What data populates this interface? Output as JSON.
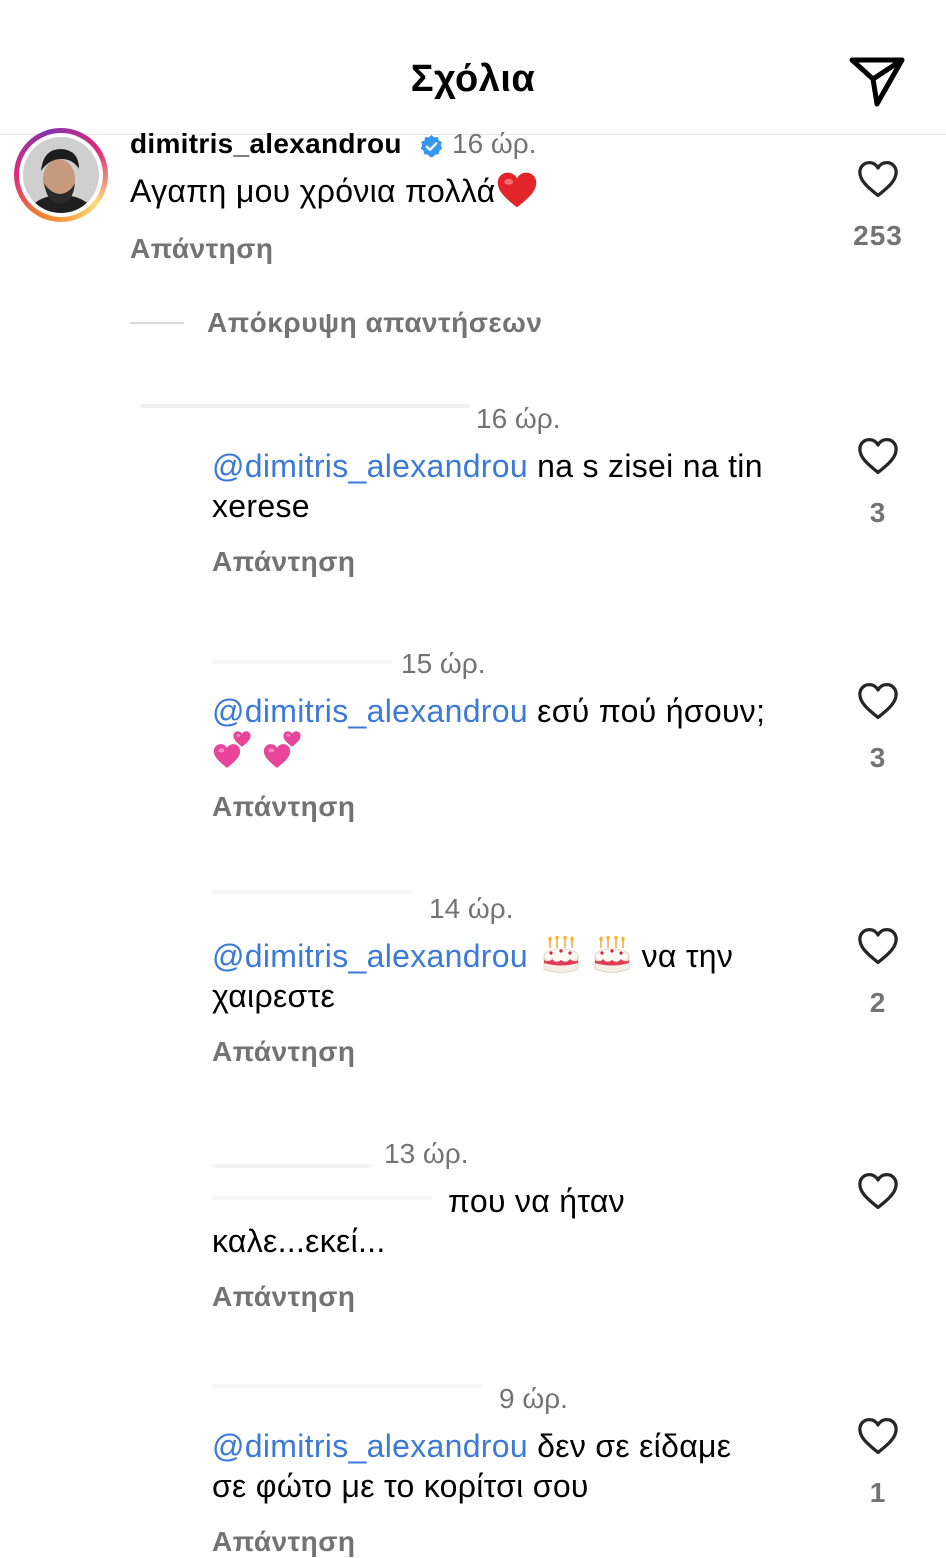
{
  "header": {
    "title": "Σχόλια"
  },
  "icons": {
    "send": "send-paper-plane-icon",
    "like": "heart-outline-icon",
    "verified": "verified-badge-icon"
  },
  "colors": {
    "mention": "#3b7ad8",
    "muted": "#737373",
    "verified": "#3797f0"
  },
  "main_comment": {
    "username": "dimitris_alexandrou",
    "time": "16 ώρ.",
    "text": "Αγαπη μου χρόνια  πολλά",
    "emoji": "red-heart",
    "reply": "Απάντηση",
    "likes": "253"
  },
  "hide_replies": "Απόκρυψη απαντήσεων",
  "replies": [
    {
      "time": "16 ώρ.",
      "mention": "@dimitris_alexandrou",
      "text_line1": " na s zisei na tin",
      "text_line2": "xerese",
      "reply": "Απάντηση",
      "likes": "3"
    },
    {
      "time": "15 ώρ.",
      "mention": "@dimitris_alexandrou",
      "text_line1": " εσύ πού ήσουν;",
      "emoji": "two-hearts",
      "reply": "Απάντηση",
      "likes": "3"
    },
    {
      "time": "14 ώρ.",
      "mention": "@dimitris_alexandrou",
      "emoji": "birthday-cake",
      "text_line1": "να την",
      "text_line2": "χαιρεστε",
      "reply": "Απάντηση",
      "likes": "2"
    },
    {
      "time": "13 ώρ.",
      "text_line1": "που να ήταν",
      "text_line2": "καλε...εκεί...",
      "reply": "Απάντηση"
    },
    {
      "time": "9 ώρ.",
      "mention": "@dimitris_alexandrou",
      "text_line1": " δεν σε είδαμε",
      "text_line2": "σε φώτο με το κορίτσι σου",
      "reply": "Απάντηση",
      "likes": "1"
    }
  ]
}
